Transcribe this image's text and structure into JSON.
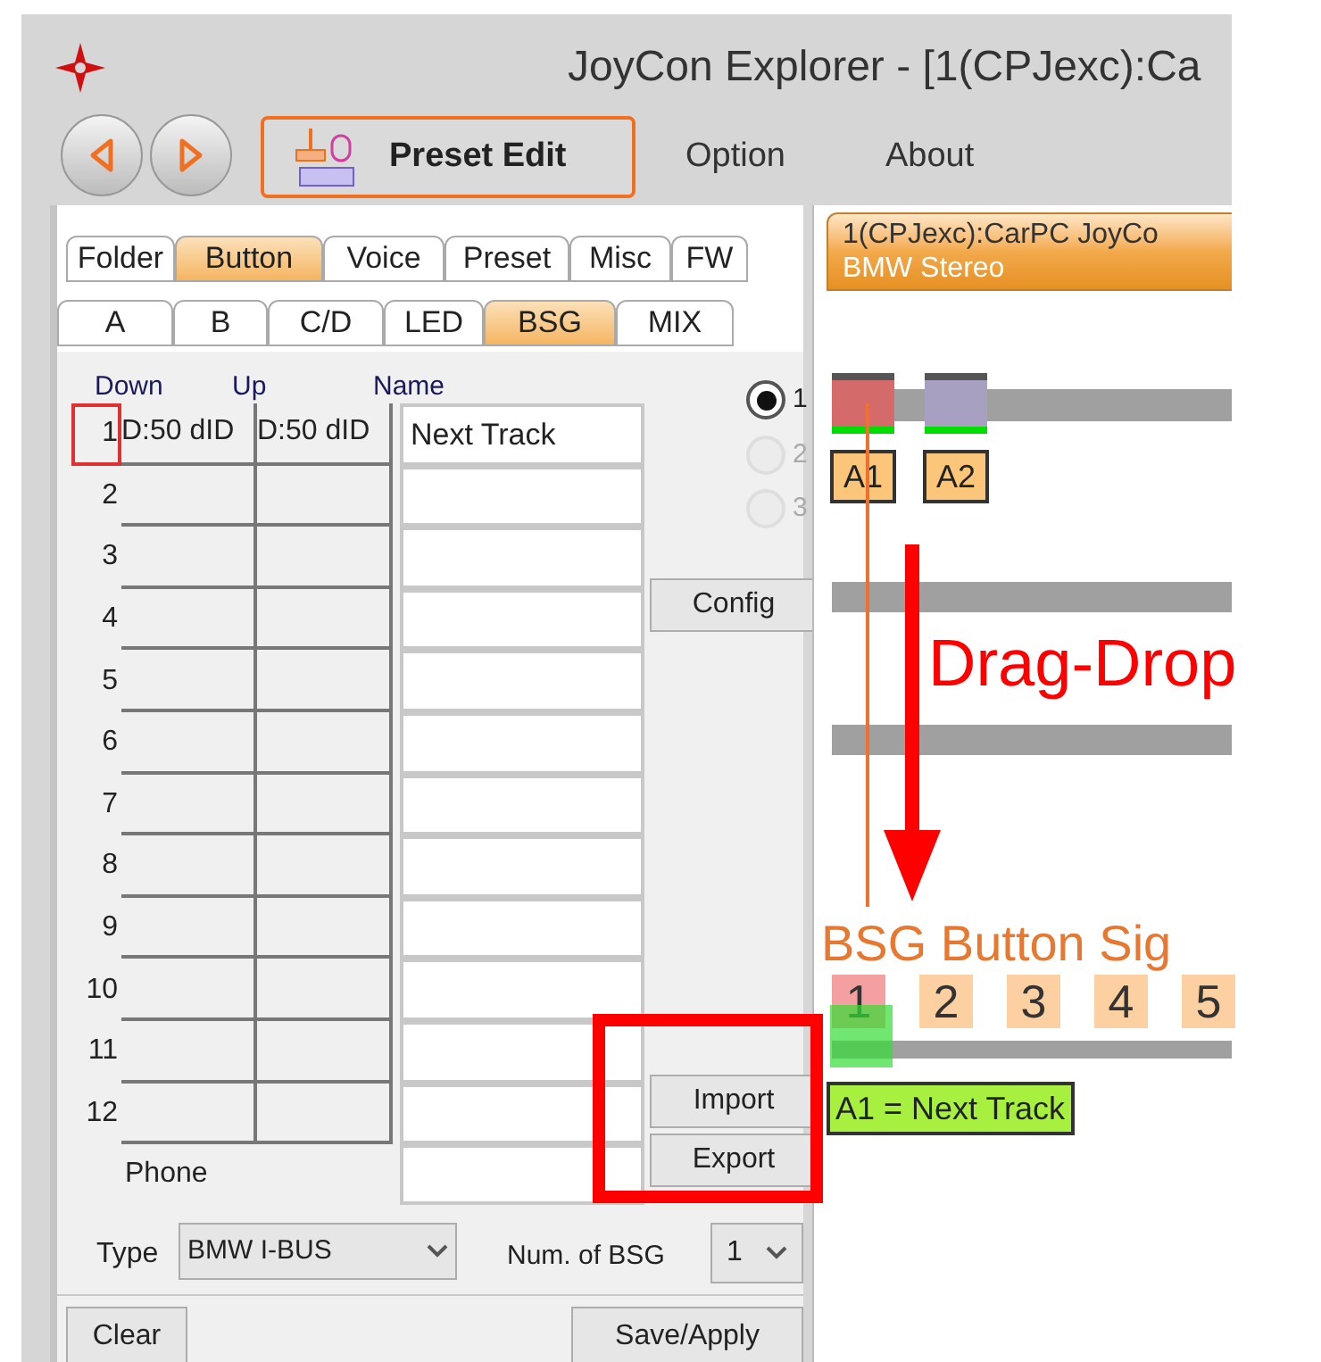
{
  "window": {
    "title": "JoyCon Explorer - [1(CPJexc):Ca"
  },
  "toolbar": [
    {
      "label": "Preset Edit",
      "selected": true
    },
    {
      "label": "Option",
      "selected": false
    },
    {
      "label": "About",
      "selected": false
    }
  ],
  "tabs": [
    {
      "label": "Folder",
      "selected": false
    },
    {
      "label": "Button",
      "selected": true
    },
    {
      "label": "Voice",
      "selected": false
    },
    {
      "label": "Preset",
      "selected": false
    },
    {
      "label": "Misc",
      "selected": false
    },
    {
      "label": "FW",
      "selected": false
    }
  ],
  "subtabs": [
    {
      "label": "A",
      "selected": false
    },
    {
      "label": "B",
      "selected": false
    },
    {
      "label": "C/D",
      "selected": false
    },
    {
      "label": "LED",
      "selected": false
    },
    {
      "label": "BSG",
      "selected": true
    },
    {
      "label": "MIX",
      "selected": false
    }
  ],
  "table": {
    "columns": [
      "Down",
      "Up",
      "Name"
    ],
    "rows": [
      {
        "number": "1",
        "down": "D:50 dID",
        "up": "D:50 dID",
        "name": "Next Track",
        "selected": true
      },
      {
        "number": "2",
        "selected": false
      },
      {
        "number": "3",
        "selected": false
      },
      {
        "number": "4",
        "selected": false
      },
      {
        "number": "5",
        "selected": false
      },
      {
        "number": "6",
        "selected": false
      },
      {
        "number": "7",
        "selected": false
      },
      {
        "number": "8",
        "selected": false
      },
      {
        "number": "9",
        "selected": false
      },
      {
        "number": "10",
        "selected": false
      },
      {
        "number": "11",
        "selected": false
      },
      {
        "number": "12",
        "selected": false
      }
    ],
    "phone_label": "Phone"
  },
  "radios": [
    {
      "label": "1",
      "selected": true,
      "disabled": false
    },
    {
      "label": "2",
      "selected": false,
      "disabled": true
    },
    {
      "label": "3",
      "selected": false,
      "disabled": true
    }
  ],
  "config_button": "Config",
  "import_button": "Import",
  "export_button": "Export",
  "type": {
    "label": "Type",
    "value": "BMW I-BUS"
  },
  "num_bsg": {
    "label": "Num. of BSG",
    "value": "1"
  },
  "clear_button": "Clear",
  "save_button": "Save/Apply",
  "device_tab": {
    "title": "1(CPJexc):CarPC JoyCo",
    "subtitle": "BMW Stereo"
  },
  "slots": [
    {
      "label": "A1",
      "color": "#d46a6a"
    },
    {
      "label": "A2",
      "color": "#a8a0c0"
    }
  ],
  "annotation": "Drag-Drop",
  "bsg_heading": "BSG Button Sig",
  "bsg_tags": [
    {
      "label": "1",
      "selected": true
    },
    {
      "label": "2",
      "selected": false
    },
    {
      "label": "3",
      "selected": false
    },
    {
      "label": "4",
      "selected": false
    },
    {
      "label": "5",
      "selected": false
    }
  ],
  "assignment": "A1 = Next Track"
}
